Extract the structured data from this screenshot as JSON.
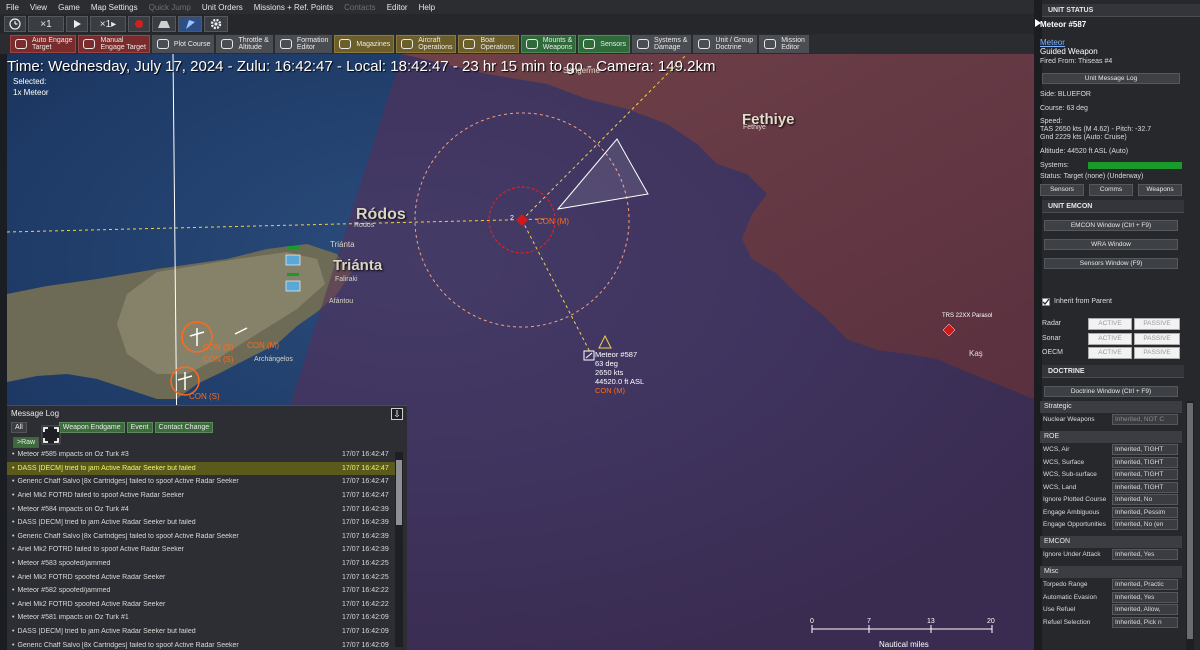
{
  "menu": {
    "items": [
      "File",
      "View",
      "Game",
      "Map Settings",
      "Quick Jump",
      "Unit Orders",
      "Missions + Ref. Points",
      "Contacts",
      "Editor",
      "Help"
    ],
    "disabled": [
      "Quick Jump",
      "Contacts"
    ]
  },
  "toolbar_time": {
    "speed1": "×1",
    "speed2": "×1▸"
  },
  "toolbar_buttons": [
    {
      "label1": "Auto Engage",
      "label2": "Target",
      "style": "red",
      "icon": "crosshair-icon"
    },
    {
      "label1": "Manual",
      "label2": "Engage Target",
      "style": "red",
      "icon": "manual-engage-icon"
    },
    {
      "label1": "Plot Course",
      "label2": "",
      "style": "gray",
      "icon": "plot-course-icon"
    },
    {
      "label1": "Throttle &",
      "label2": "Altitude",
      "style": "gray",
      "icon": "throttle-icon"
    },
    {
      "label1": "Formation",
      "label2": "Editor",
      "style": "gray",
      "icon": "formation-icon"
    },
    {
      "label1": "Magazines",
      "label2": "",
      "style": "gold",
      "icon": "magazines-icon"
    },
    {
      "label1": "Aircraft",
      "label2": "Operations",
      "style": "gold",
      "icon": "aircraft-icon"
    },
    {
      "label1": "Boat",
      "label2": "Operations",
      "style": "gold",
      "icon": "boat-icon"
    },
    {
      "label1": "Mounts &",
      "label2": "Weapons",
      "style": "green",
      "icon": "mounts-icon"
    },
    {
      "label1": "Sensors",
      "label2": "",
      "style": "green",
      "icon": "sensors-icon"
    },
    {
      "label1": "Systems &",
      "label2": "Damage",
      "style": "gray",
      "icon": "systems-icon"
    },
    {
      "label1": "Unit / Group",
      "label2": "Doctrine",
      "style": "gray",
      "icon": "doctrine-icon"
    },
    {
      "label1": "Mission",
      "label2": "Editor",
      "style": "gray",
      "icon": "mission-editor-icon"
    }
  ],
  "map": {
    "time_bar": "Time: Wednesday, July 17, 2024 - Zulu: 16:42:47 - Local: 18:42:47 - 23 hr 15 min to go - Camera: 149.2km",
    "selected_label": "Selected:",
    "selected_value": "1x Meteor",
    "places": {
      "rodos": "Ródos",
      "rodos_small": "Rodos",
      "trianta_small": "Triánta",
      "trianta": "Triánta",
      "faliraki": "Faliraki",
      "afantou": "Afántou",
      "archangelos": "Archángelos",
      "fethiye": "Fethiye",
      "fethiye_small": "Fethiye",
      "sarigerme": "Sarigerme",
      "kas": "Kaş"
    },
    "units": {
      "con_m_center": "CON (M)",
      "con_s_1": "CON (S)",
      "con_s_2": "CON (S)",
      "con_m_left": "CON (M)",
      "con_s_3": "CON (S)",
      "marker_num": "2",
      "parasol": "TRS 22XX Parasol"
    },
    "meteor_label": {
      "name": "Meteor #587",
      "course": "63 deg",
      "speed": "2650 kts",
      "alt": "44520.0 ft ASL",
      "con": "CON (M)"
    },
    "scale": {
      "ticks": [
        "0",
        "7",
        "13",
        "20"
      ],
      "unit": "Nautical miles"
    }
  },
  "message_log": {
    "title": "Message Log",
    "filters": [
      "All",
      "Weapon Endgame",
      "Event",
      "Contact Change"
    ],
    "raw": ">Raw",
    "rows": [
      {
        "msg": "Meteor #585 impacts on Oz Turk #3",
        "ts": "17/07 16:42:47",
        "hl": false
      },
      {
        "msg": "DASS [DECM] tried to jam Active Radar Seeker but failed",
        "ts": "17/07 16:42:47",
        "hl": true
      },
      {
        "msg": "Generic Chaff Salvo [8x Cartridges] failed to spoof Active Radar Seeker",
        "ts": "17/07 16:42:47",
        "hl": false
      },
      {
        "msg": "Ariel Mk2 FOTRD failed to spoof Active Radar Seeker",
        "ts": "17/07 16:42:47",
        "hl": false
      },
      {
        "msg": "Meteor #584 impacts on Oz Turk #4",
        "ts": "17/07 16:42:39",
        "hl": false
      },
      {
        "msg": "DASS [DECM] tried to jam Active Radar Seeker but failed",
        "ts": "17/07 16:42:39",
        "hl": false
      },
      {
        "msg": "Generic Chaff Salvo [8x Cartridges] failed to spoof Active Radar Seeker",
        "ts": "17/07 16:42:39",
        "hl": false
      },
      {
        "msg": "Ariel Mk2 FOTRD failed to spoof Active Radar Seeker",
        "ts": "17/07 16:42:39",
        "hl": false
      },
      {
        "msg": "Meteor #583 spoofed/jammed",
        "ts": "17/07 16:42:25",
        "hl": false
      },
      {
        "msg": "Ariel Mk2 FOTRD spoofed Active Radar Seeker",
        "ts": "17/07 16:42:25",
        "hl": false
      },
      {
        "msg": "Meteor #582 spoofed/jammed",
        "ts": "17/07 16:42:22",
        "hl": false
      },
      {
        "msg": "Ariel Mk2 FOTRD spoofed Active Radar Seeker",
        "ts": "17/07 16:42:22",
        "hl": false
      },
      {
        "msg": "Meteor #581 impacts on Oz Turk #1",
        "ts": "17/07 16:42:09",
        "hl": false
      },
      {
        "msg": "DASS [DECM] tried to jam Active Radar Seeker but failed",
        "ts": "17/07 16:42:09",
        "hl": false
      },
      {
        "msg": "Generic Chaff Salvo [8x Cartridges] failed to spoof Active Radar Seeker",
        "ts": "17/07 16:42:09",
        "hl": false
      }
    ]
  },
  "unit_status": {
    "section": "UNIT STATUS",
    "name": "Meteor #587",
    "class": "Meteor",
    "type": "Guided Weapon",
    "fired_from": "Fired From: Thiseas #4",
    "msg_log_btn": "Unit Message Log",
    "side": "Side: BLUEFOR",
    "course": "Course: 63 deg",
    "speed_label": "Speed:",
    "tas": "TAS 2650 kts (M 4.62) - Pitch: -32.7",
    "gnd": "Gnd 2229 kts (Auto: Cruise)",
    "altitude": "Altitude: 44520 ft ASL (Auto)",
    "systems": "Systems:",
    "status": "Status: Target (none) (Underway)",
    "tabs": [
      "Sensors",
      "Comms",
      "Weapons"
    ],
    "systems_health": 1.0
  },
  "emcon": {
    "section": "UNIT EMCON",
    "buttons": [
      "EMCON Window (Ctrl + F9)",
      "WRA Window",
      "Sensors Window (F9)"
    ],
    "inherit": "Inherit from Parent",
    "rows": [
      {
        "label": "Radar",
        "a": "ACTIVE",
        "p": "PASSIVE"
      },
      {
        "label": "Sonar",
        "a": "ACTIVE",
        "p": "PASSIVE"
      },
      {
        "label": "OECM",
        "a": "ACTIVE",
        "p": "PASSIVE"
      }
    ]
  },
  "doctrine": {
    "section": "DOCTRINE",
    "window_btn": "Doctrine Window (Ctrl + F9)",
    "strategic": "Strategic",
    "nuclear_label": "Nuclear Weapons",
    "nuclear_val": "Inherited, NOT C",
    "roe": "ROE",
    "roe_rows": [
      {
        "label": "WCS, Air",
        "val": "Inherited, TIGHT"
      },
      {
        "label": "WCS, Surface",
        "val": "Inherited, TIGHT"
      },
      {
        "label": "WCS, Sub-surface",
        "val": "Inherited, TIGHT"
      },
      {
        "label": "WCS, Land",
        "val": "Inherited, TIGHT"
      },
      {
        "label": "Ignore Plotted Course",
        "val": "Inherited, No"
      },
      {
        "label": "Engage Ambiguous",
        "val": "Inherited, Pessim"
      },
      {
        "label": "Engage Opportunities",
        "val": "Inherited, No (en"
      }
    ],
    "emcon": "EMCON",
    "emcon_rows": [
      {
        "label": "Ignore Under Attack",
        "val": "Inherited, Yes"
      }
    ],
    "misc": "Misc",
    "misc_rows": [
      {
        "label": "Torpedo Range",
        "val": "Inherited, Practic"
      },
      {
        "label": "Automatic Evasion",
        "val": "Inherited, Yes"
      },
      {
        "label": "Use Refuel",
        "val": "Inherited, Allow,"
      },
      {
        "label": "Refuel Selection",
        "val": "Inherited, Pick n"
      }
    ]
  },
  "colors": {
    "sea_blue": "#1d3a66",
    "overlay_purple": "#4b2e4a",
    "land_brown": "#7a4a30",
    "con_orange": "#ff6a1a",
    "track_yellow": "#f0d24a",
    "hostile_red": "#d01818",
    "green_ok": "#1a9a2a"
  }
}
